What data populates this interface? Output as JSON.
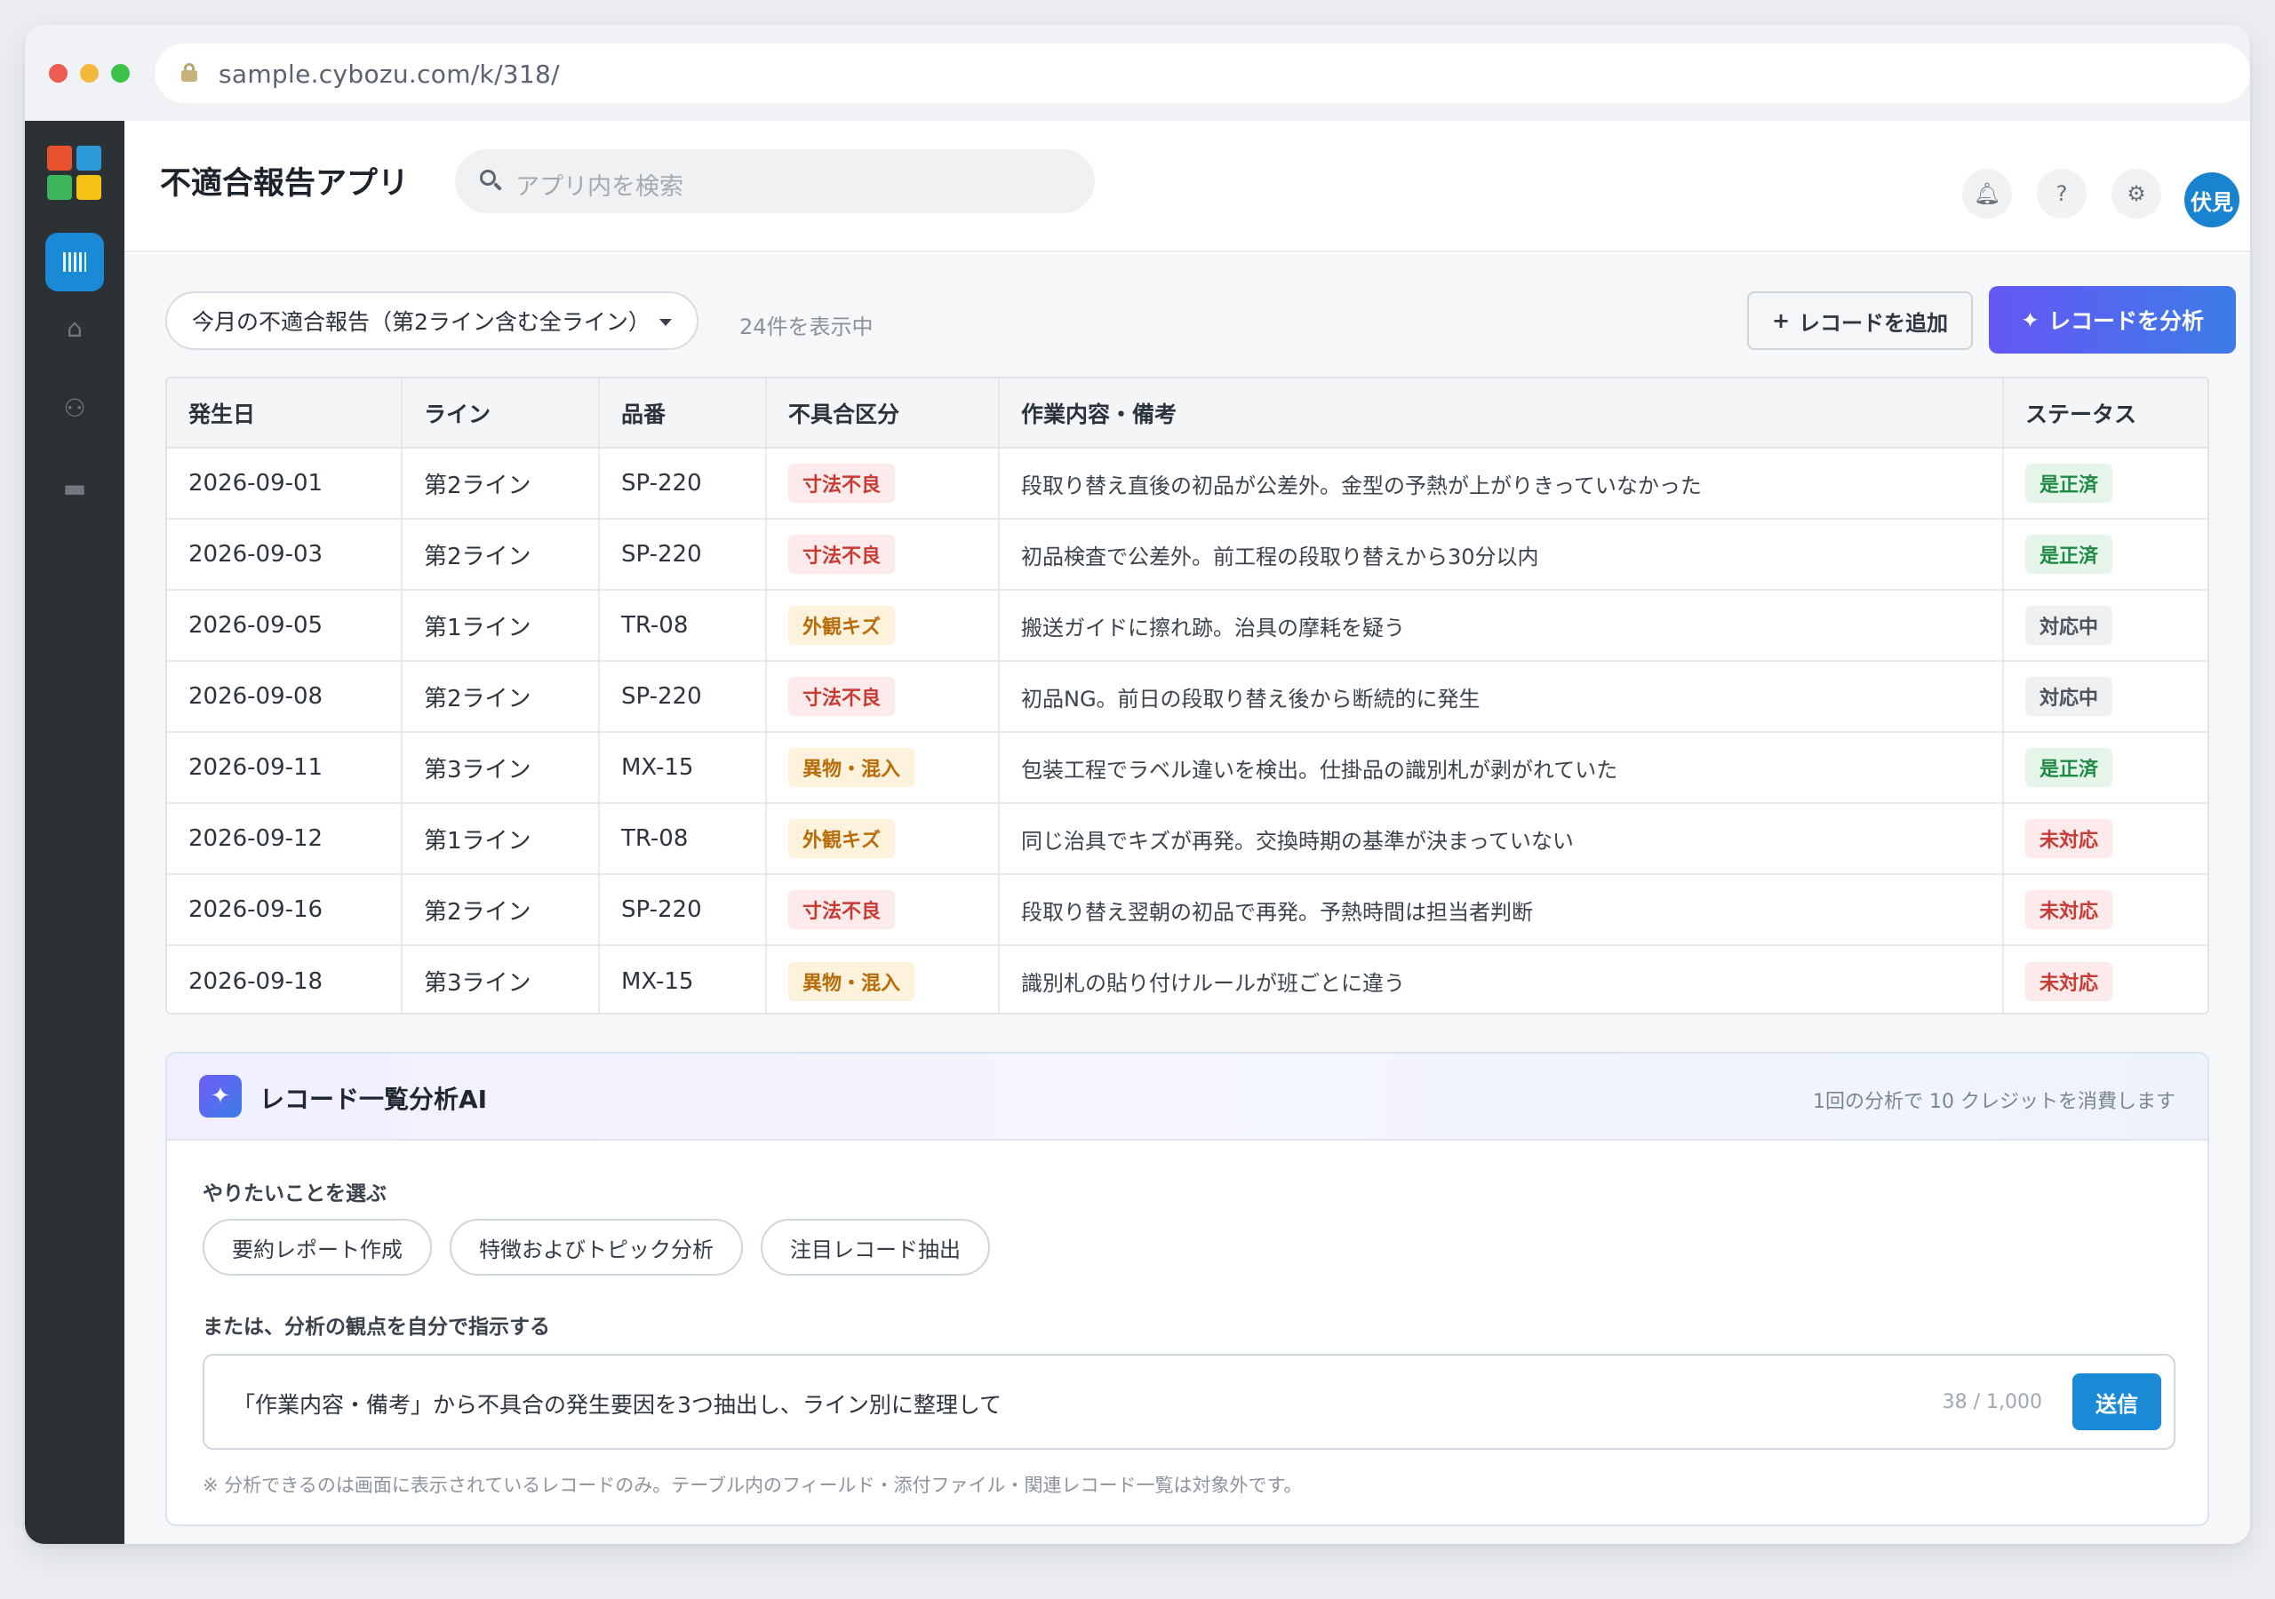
{
  "browser": {
    "url": "sample.cybozu.com/k/318/"
  },
  "app": {
    "title": "不適合報告アプリ",
    "search_placeholder": "アプリ内を検索",
    "user_name": "伏見",
    "help_label": "?"
  },
  "toolbar": {
    "view_name": "今月の不適合報告（第2ライン含む全ライン）",
    "record_count": "24件を表示中",
    "add_label": "レコードを追加",
    "analyze_label": "レコードを分析"
  },
  "table": {
    "columns": [
      "発生日",
      "ライン",
      "品番",
      "不具合区分",
      "作業内容・備考",
      "ステータス"
    ],
    "rows": [
      [
        "2026-09-01",
        "第2ライン",
        "SP-220",
        "寸法不良",
        "段取り替え直後の初品が公差外。金型の予熱が上がりきっていなかった",
        "是正済"
      ],
      [
        "2026-09-03",
        "第2ライン",
        "SP-220",
        "寸法不良",
        "初品検査で公差外。前工程の段取り替えから30分以内",
        "是正済"
      ],
      [
        "2026-09-05",
        "第1ライン",
        "TR-08",
        "外観キズ",
        "搬送ガイドに擦れ跡。治具の摩耗を疑う",
        "対応中"
      ],
      [
        "2026-09-08",
        "第2ライン",
        "SP-220",
        "寸法不良",
        "初品NG。前日の段取り替え後から断続的に発生",
        "対応中"
      ],
      [
        "2026-09-11",
        "第3ライン",
        "MX-15",
        "異物・混入",
        "包装工程でラベル違いを検出。仕掛品の識別札が剥がれていた",
        "是正済"
      ],
      [
        "2026-09-12",
        "第1ライン",
        "TR-08",
        "外観キズ",
        "同じ治具でキズが再発。交換時期の基準が決まっていない",
        "未対応"
      ],
      [
        "2026-09-16",
        "第2ライン",
        "SP-220",
        "寸法不良",
        "段取り替え翌朝の初品で再発。予熱時間は担当者判断",
        "未対応"
      ],
      [
        "2026-09-18",
        "第3ライン",
        "MX-15",
        "異物・混入",
        "識別札の貼り付けルールが班ごとに違う",
        "未対応"
      ]
    ]
  },
  "ai_panel": {
    "title": "レコード一覧分析AI",
    "credits_note": "1回の分析で 10 クレジットを消費します",
    "choose_label": "やりたいことを選ぶ",
    "chips": [
      "要約レポート作成",
      "特徴およびトピック分析",
      "注目レコード抽出"
    ],
    "custom_label": "または、分析の観点を自分で指示する",
    "prompt_text": "「作業内容・備考」から不具合の発生要因を3つ抽出し、ライン別に整理して",
    "char_count": "38 / 1,000",
    "send_label": "送信",
    "footnote": "※ 分析できるのは画面に表示されているレコードのみ。テーブル内のフィールド・添付ファイル・関連レコード一覧は対象外です。"
  },
  "colors": {
    "accent_blue": "#1a8ad6",
    "analyze_gradient_start": "#6557f5",
    "analyze_gradient_end": "#3d7ce8",
    "status_done": "#1f8a43",
    "status_todo": "#c63b33",
    "defect_red": "#c63b33",
    "defect_amber": "#b86c0a"
  }
}
